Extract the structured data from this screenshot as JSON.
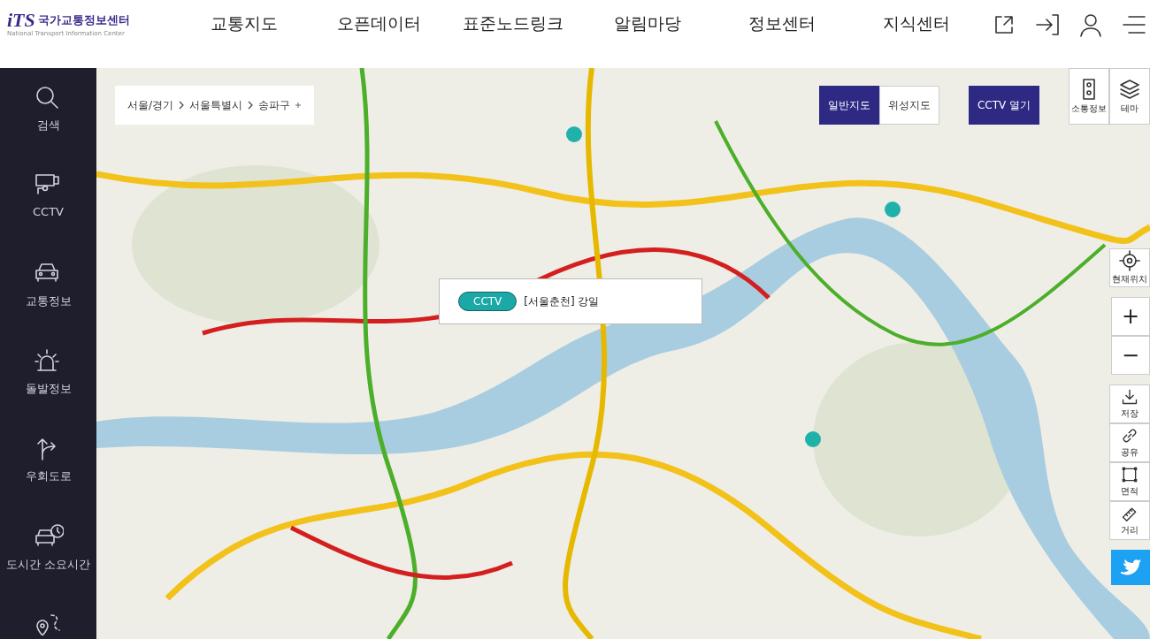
{
  "header": {
    "logo": {
      "mark": "iTS",
      "title": "국가교통정보센터",
      "subtitle": "National Transport Information Center"
    },
    "nav": [
      {
        "label": "교통지도"
      },
      {
        "label": "오픈데이터"
      },
      {
        "label": "표준노드링크"
      },
      {
        "label": "알림마당"
      },
      {
        "label": "정보센터"
      },
      {
        "label": "지식센터"
      }
    ]
  },
  "sidebar": {
    "items": [
      {
        "label": "검색"
      },
      {
        "label": "CCTV"
      },
      {
        "label": "교통정보"
      },
      {
        "label": "돌발정보"
      },
      {
        "label": "우회도로"
      },
      {
        "label": "도시간 소요시간"
      }
    ]
  },
  "map": {
    "kind": "picture",
    "breadcrumb": [
      "서울/경기",
      "서울특별시",
      "송파구"
    ],
    "map_types": [
      {
        "label": "일반지도",
        "selected": true
      },
      {
        "label": "위성지도",
        "selected": false
      }
    ],
    "cctv_button": "CCTV 열기",
    "layer_buttons": [
      {
        "label": "소통정보"
      },
      {
        "label": "테마"
      }
    ],
    "location_button": "현재위치",
    "zoom_in": "+",
    "zoom_out": "−",
    "tools": [
      {
        "label": "저장"
      },
      {
        "label": "공유"
      },
      {
        "label": "면적"
      },
      {
        "label": "거리"
      }
    ],
    "popup": {
      "badge": "CCTV",
      "name": "[서울춘천] 강일"
    }
  }
}
